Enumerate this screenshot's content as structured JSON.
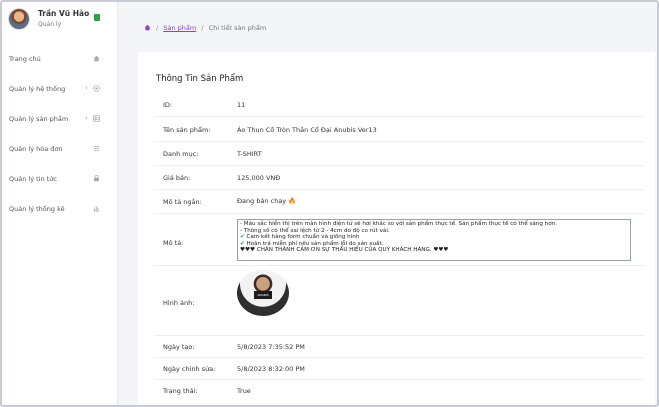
{
  "profile": {
    "name": "Trần Vũ Hào",
    "role": "Quản lý"
  },
  "sidebar": {
    "items": [
      {
        "label": "Trang chủ",
        "icon": "home-icon"
      },
      {
        "label": "Quản lý hệ thống",
        "icon": "plus-circle-icon"
      },
      {
        "label": "Quản lý sản phẩm",
        "icon": "grid-icon"
      },
      {
        "label": "Quản lý hóa đơn",
        "icon": "list-icon"
      },
      {
        "label": "Quản lý tin tức",
        "icon": "lock-icon"
      },
      {
        "label": "Quản lý thống kê",
        "icon": "bar-chart-icon"
      }
    ]
  },
  "breadcrumb": {
    "link": "Sản phẩm",
    "current": "Chi tiết sản phẩm"
  },
  "card": {
    "title": "Thông Tin Sản Phẩm",
    "fields": {
      "id": {
        "label": "ID:",
        "value": "11"
      },
      "name": {
        "label": "Tên sản phẩm:",
        "value": "Áo Thun Cổ Tròn Thần Cổ Đại Anubis Ver13"
      },
      "category": {
        "label": "Danh mục:",
        "value": "T-SHIRT"
      },
      "price": {
        "label": "Giá bán:",
        "value": "125,000 VNĐ"
      },
      "short_desc": {
        "label": "Mô tả ngắn:",
        "value": "Đang bán chạy 🔥"
      },
      "desc": {
        "label": "Mô tả:",
        "lines": [
          "- Màu sắc hiển thị trên màn hình điện tử sẽ hơi khác so với sản phẩm thực tế. Sản phẩm thực tế có thể sáng hơn.",
          "- Thông số có thể sai lệch từ 2 - 4cm do độ co rút vải.",
          "Cam kết hàng form chuẩn và giống hình",
          "Hoàn trả miễn phí nếu sản phẩm lỗi do sản xuất.",
          "♥♥♥ CHÂN THÀNH CẢM ƠN SỰ THẤU HIỂU CỦA QUÝ KHÁCH HÀNG. ♥♥♥"
        ],
        "check_glyph": "✔"
      },
      "image": {
        "label": "Hình ảnh:",
        "print_text": "ANUBIS"
      },
      "created": {
        "label": "Ngày tạo:",
        "value": "5/8/2023 7:35:52 PM"
      },
      "edited": {
        "label": "Ngày chỉnh sửa:",
        "value": "5/8/2023 8:32:00 PM"
      },
      "status": {
        "label": "Trạng thái:",
        "value": "True"
      }
    }
  },
  "colors": {
    "accent": "#8a44c3",
    "check": "#1e9e3a",
    "badge": "#2e9e49"
  }
}
